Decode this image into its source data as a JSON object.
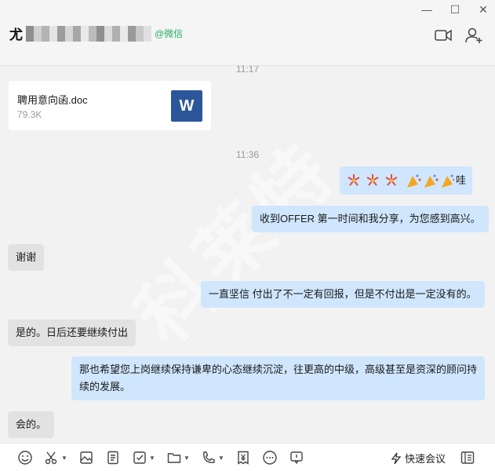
{
  "window": {
    "minimize_glyph": "—",
    "maximize_glyph": "☐",
    "close_glyph": "✕"
  },
  "header": {
    "contact_name": "尤",
    "contact_tag": "@微信",
    "video_icon": "video-call-icon",
    "add_member_icon": "add-member-icon"
  },
  "messages": {
    "time_1": "11:17",
    "file_name": "聘用意向函.doc",
    "file_size": "79.3K",
    "file_type_letter": "W",
    "time_2": "11:36",
    "emoji_msg_text": "哇",
    "m1": "收到OFFER 第一时间和我分享，为您感到高兴。",
    "m2": "谢谢",
    "m3": "一直坚信 付出了不一定有回报，但是不付出是一定没有的。",
    "m4": "是的。日后还要继续付出",
    "m5": "那也希望您上岗继续保持谦卑的心态继续沉淀，往更高的中级，高级甚至是资深的顾问持续的发展。",
    "m6": "会的。"
  },
  "toolbar": {
    "quick_meeting_label": "快速会议"
  },
  "colors": {
    "my_bubble": "#cfe6fd",
    "their_bubble": "#e2e2e2",
    "wechat_green": "#2aae67",
    "word_blue": "#2b579a"
  }
}
